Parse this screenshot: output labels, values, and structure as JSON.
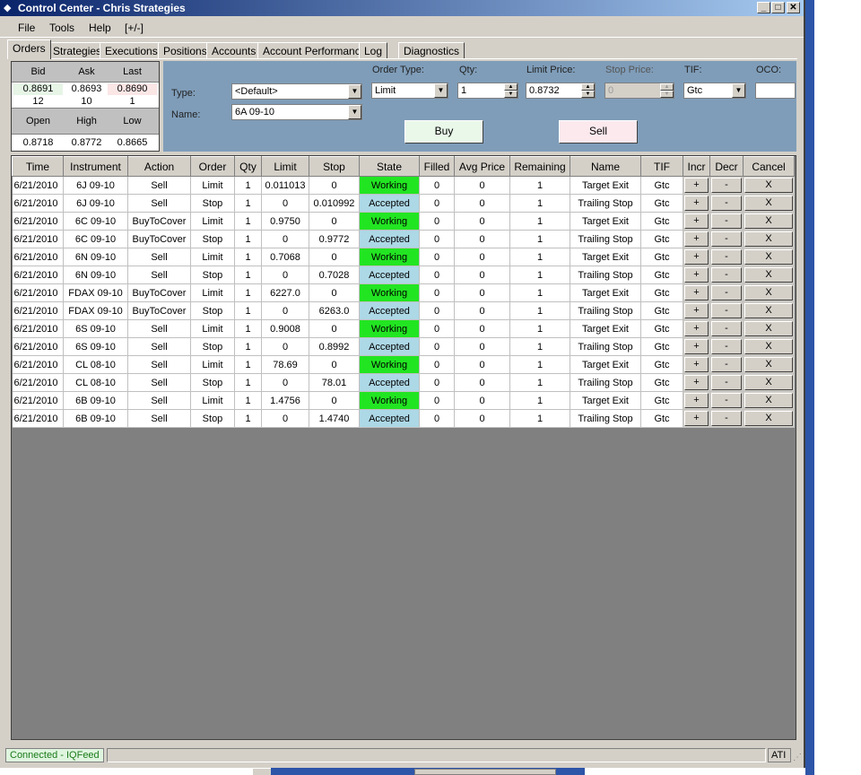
{
  "window": {
    "title": "Control Center - Chris Strategies"
  },
  "menu": [
    "File",
    "Tools",
    "Help",
    "[+/-]"
  ],
  "tabs": [
    "Orders",
    "Strategies",
    "Executions",
    "Positions",
    "Accounts",
    "Account Performance",
    "Log",
    "Diagnostics"
  ],
  "quote": {
    "headers1": [
      "Bid",
      "Ask",
      "Last"
    ],
    "prices": [
      "0.8691",
      "0.8693",
      "0.8690"
    ],
    "sizes": [
      "12",
      "10",
      "1"
    ],
    "headers2": [
      "Open",
      "High",
      "Low"
    ],
    "ohl": [
      "0.8718",
      "0.8772",
      "0.8665"
    ]
  },
  "entry": {
    "type_label": "Type:",
    "type_value": "<Default>",
    "name_label": "Name:",
    "name_value": "6A 09-10",
    "order_type_label": "Order Type:",
    "order_type_value": "Limit",
    "qty_label": "Qty:",
    "qty_value": "1",
    "limit_label": "Limit Price:",
    "limit_value": "0.8732",
    "stop_label": "Stop Price:",
    "stop_value": "0",
    "tif_label": "TIF:",
    "tif_value": "Gtc",
    "oco_label": "OCO:",
    "oco_value": "",
    "buy_label": "Buy",
    "sell_label": "Sell"
  },
  "grid": {
    "columns": [
      "Time",
      "Instrument",
      "Action",
      "Order",
      "Qty",
      "Limit",
      "Stop",
      "State",
      "Filled",
      "Avg Price",
      "Remaining",
      "Name",
      "TIF",
      "Incr",
      "Decr",
      "Cancel"
    ],
    "rows": [
      [
        "6/21/2010",
        "6J 09-10",
        "Sell",
        "Limit",
        "1",
        "0.011013",
        "0",
        "Working",
        "0",
        "0",
        "1",
        "Target Exit",
        "Gtc",
        "+",
        "-",
        "X"
      ],
      [
        "6/21/2010",
        "6J 09-10",
        "Sell",
        "Stop",
        "1",
        "0",
        "0.010992",
        "Accepted",
        "0",
        "0",
        "1",
        "Trailing Stop",
        "Gtc",
        "+",
        "-",
        "X"
      ],
      [
        "6/21/2010",
        "6C 09-10",
        "BuyToCover",
        "Limit",
        "1",
        "0.9750",
        "0",
        "Working",
        "0",
        "0",
        "1",
        "Target Exit",
        "Gtc",
        "+",
        "-",
        "X"
      ],
      [
        "6/21/2010",
        "6C 09-10",
        "BuyToCover",
        "Stop",
        "1",
        "0",
        "0.9772",
        "Accepted",
        "0",
        "0",
        "1",
        "Trailing Stop",
        "Gtc",
        "+",
        "-",
        "X"
      ],
      [
        "6/21/2010",
        "6N 09-10",
        "Sell",
        "Limit",
        "1",
        "0.7068",
        "0",
        "Working",
        "0",
        "0",
        "1",
        "Target Exit",
        "Gtc",
        "+",
        "-",
        "X"
      ],
      [
        "6/21/2010",
        "6N 09-10",
        "Sell",
        "Stop",
        "1",
        "0",
        "0.7028",
        "Accepted",
        "0",
        "0",
        "1",
        "Trailing Stop",
        "Gtc",
        "+",
        "-",
        "X"
      ],
      [
        "6/21/2010",
        "FDAX 09-10",
        "BuyToCover",
        "Limit",
        "1",
        "6227.0",
        "0",
        "Working",
        "0",
        "0",
        "1",
        "Target Exit",
        "Gtc",
        "+",
        "-",
        "X"
      ],
      [
        "6/21/2010",
        "FDAX 09-10",
        "BuyToCover",
        "Stop",
        "1",
        "0",
        "6263.0",
        "Accepted",
        "0",
        "0",
        "1",
        "Trailing Stop",
        "Gtc",
        "+",
        "-",
        "X"
      ],
      [
        "6/21/2010",
        "6S 09-10",
        "Sell",
        "Limit",
        "1",
        "0.9008",
        "0",
        "Working",
        "0",
        "0",
        "1",
        "Target Exit",
        "Gtc",
        "+",
        "-",
        "X"
      ],
      [
        "6/21/2010",
        "6S 09-10",
        "Sell",
        "Stop",
        "1",
        "0",
        "0.8992",
        "Accepted",
        "0",
        "0",
        "1",
        "Trailing Stop",
        "Gtc",
        "+",
        "-",
        "X"
      ],
      [
        "6/21/2010",
        "CL 08-10",
        "Sell",
        "Limit",
        "1",
        "78.69",
        "0",
        "Working",
        "0",
        "0",
        "1",
        "Target Exit",
        "Gtc",
        "+",
        "-",
        "X"
      ],
      [
        "6/21/2010",
        "CL 08-10",
        "Sell",
        "Stop",
        "1",
        "0",
        "78.01",
        "Accepted",
        "0",
        "0",
        "1",
        "Trailing Stop",
        "Gtc",
        "+",
        "-",
        "X"
      ],
      [
        "6/21/2010",
        "6B 09-10",
        "Sell",
        "Limit",
        "1",
        "1.4756",
        "0",
        "Working",
        "0",
        "0",
        "1",
        "Target Exit",
        "Gtc",
        "+",
        "-",
        "X"
      ],
      [
        "6/21/2010",
        "6B 09-10",
        "Sell",
        "Stop",
        "1",
        "0",
        "1.4740",
        "Accepted",
        "0",
        "0",
        "1",
        "Trailing Stop",
        "Gtc",
        "+",
        "-",
        "X"
      ]
    ]
  },
  "status": {
    "connection": "Connected - IQFeed",
    "account": "ATI"
  },
  "colors": {
    "working": "#22e522",
    "accepted": "#add8e6",
    "title_start": "#0a246a",
    "title_end": "#a6caf0"
  }
}
